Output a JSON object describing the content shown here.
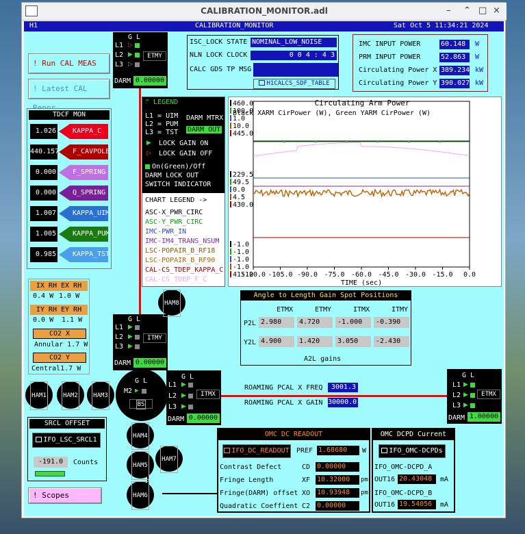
{
  "window": {
    "title": "CALIBRATION_MONITOR.adl",
    "controls": [
      "–",
      "□",
      "×"
    ]
  },
  "header": {
    "ifo": "H1",
    "title": "CALIBRATION_MONITOR",
    "datetime": "Sat Oct  5 11:34:21 2024"
  },
  "buttons": {
    "run_cal": "! Run CAL MEAS",
    "latest_cal": "! Latest CAL Repor",
    "scopes": "! Scopes"
  },
  "tdcf": {
    "title": "TDCF MON",
    "rows": [
      {
        "value": "1.026",
        "label": "KAPPA_C",
        "color": "#e8001c"
      },
      {
        "value": "440.157",
        "label": "F_CAVPOLE",
        "color": "#b00000"
      },
      {
        "value": "0.000",
        "label": "F_SPRING",
        "color": "#c070e0"
      },
      {
        "value": "0.000",
        "label": "Q_SPRING",
        "color": "#7a1f9a"
      },
      {
        "value": "1.007",
        "label": "KAPPA_UIM",
        "color": "#2a70d0"
      },
      {
        "value": "1.005",
        "label": "KAPPA_PUM",
        "color": "#1a7a10"
      },
      {
        "value": "0.985",
        "label": "KAPPA_TST",
        "color": "#4aa0e8"
      }
    ]
  },
  "ring_heaters": {
    "x_label": "IX RH EX RH",
    "x_vals": [
      "0.4 W",
      "1.0  W"
    ],
    "y_label": "IY RH EY RH",
    "y_vals": [
      "0.0 W",
      "1.1 W"
    ],
    "co2x_label": "CO2 X",
    "annular": "Annular 1.7 W",
    "co2y_label": "CO2 Y",
    "central": "Central1.7  W"
  },
  "srcl": {
    "title": "SRCL OFFSET",
    "button": "IFO_LSC_SRCL1",
    "value": "-191.0",
    "unit": "Counts"
  },
  "isc": {
    "state_label": "ISC_LOCK STATE",
    "state_value": "NOMINAL_LOW_NOISE",
    "nln_label": "NLN LOCK CLOCK",
    "nln_value": "0 0 4 : 4 3",
    "calc_label": "CALC GDS TP MSG",
    "sdf_button": "H1CALCS_SDF_TABLE"
  },
  "power": {
    "rows": [
      {
        "label": "IMC INPUT POWER",
        "value": "60.148",
        "unit": "W"
      },
      {
        "label": "PRM INPUT POWER",
        "value": "52.863",
        "unit": "W"
      },
      {
        "label": "Circulating Power X",
        "value": "389.234",
        "unit": "kW"
      },
      {
        "label": "Circulating Power Y",
        "value": "390.027",
        "unit": "kW"
      }
    ]
  },
  "legend": {
    "title": "LEGEND",
    "l1": "L1 = UIM",
    "l2": "L2 = PUM",
    "l3": "L3 = TST",
    "darm_mtrx": "DARM MTRX",
    "darm_out": "DARM OUT",
    "gain_on": "LOCK GAIN ON",
    "gain_off": "LOCK GAIN OFF",
    "onoff": "On(Green)/Off",
    "lockout": "DARM LOCK OUT",
    "switch": "SWITCH INDICATOR",
    "chart_legend": "CHART LEGEND  ->",
    "channels": [
      {
        "name": "ASC-X_PWR_CIRC",
        "color": "#000000"
      },
      {
        "name": "ASC-Y_PWR_CIRC",
        "color": "#10a010"
      },
      {
        "name": "IMC-PWR_IN",
        "color": "#2a4ad0"
      },
      {
        "name": "IMC-IM4_TRANS_NSUM",
        "color": "#7a2ab0"
      },
      {
        "name": "LSC-POPAIR_B_RF18",
        "color": "#8a5a00"
      },
      {
        "name": "LSC-POPAIR_B_RF90",
        "color": "#c06000"
      },
      {
        "name": "CAL-CS_TDEP_KAPPA_C",
        "color": "#a00000"
      },
      {
        "name": "CAL-CS_TDEP_F_C",
        "color": "#ffa0ff"
      }
    ]
  },
  "chart": {
    "title": "Circulating Arm Power",
    "subtitle": "Black XARM CirPower (W), Green YARM CirPower (W)",
    "xlabel": "TIME (sec)",
    "y_group1": [
      "460.0",
      "100.0",
      "1.0",
      "10.0",
      "445.0"
    ],
    "y_group2": [
      "229.5",
      "49.5",
      "0.0",
      "4.5",
      "430.0"
    ],
    "y_group3": [
      "-1.0",
      "-1.0",
      "-1.0",
      "-1.0",
      "415.0"
    ]
  },
  "chart_data": {
    "type": "line",
    "title": "Circulating Arm Power",
    "xlabel": "TIME (sec)",
    "x_ticks": [
      "-120.0",
      "-105.0",
      "-90.0",
      "-75.0",
      "-60.0",
      "-45.0",
      "-30.0",
      "-15.0",
      "0.0"
    ],
    "xlim": [
      -120,
      0
    ]
  },
  "a2l": {
    "title": "Angle to Length Gain Spot Positions",
    "cols": [
      "ETMX",
      "ETMY",
      "ITMX",
      "ITMY"
    ],
    "p2l_label": "P2L",
    "p2l": [
      "2.980",
      "4.720",
      "-1.000",
      "-0.390"
    ],
    "y2l_label": "Y2L",
    "y2l": [
      "4.900",
      "1.420",
      "3.050",
      "-2.430"
    ],
    "footer": "A2L gains"
  },
  "pcal": {
    "freq_label": "ROAMING PCAL X FREQ",
    "freq_value": "3001.3",
    "gain_label": "ROAMING PCAL X GAIN",
    "gain_value": "30000.0"
  },
  "omc": {
    "title": "OMC DC READOUT",
    "button": "IFO_DC_READOUT",
    "pref_label": "PREF",
    "pref_value": "1.68680",
    "pref_unit": "W",
    "rows": [
      {
        "label": "Contrast Defect",
        "code": "CD",
        "value": "0.00000",
        "unit": ""
      },
      {
        "label": "Fringe Length",
        "code": "XF",
        "value": "10.32000",
        "unit": "pm"
      },
      {
        "label": "Fringe(DARM) offset",
        "code": "XO",
        "value": "10.93948",
        "unit": "pm"
      },
      {
        "label": "Quadratic Coeffient",
        "code": "C2",
        "value": "0.00000",
        "unit": ""
      }
    ]
  },
  "dcpd": {
    "title": "OMC DCPD Current",
    "button": "IFO_OMC-DCPDs",
    "a_label": "IFO_OMC-DCPD_A",
    "a_out": "OUT16",
    "a_value": "20.43048",
    "a_unit": "mA",
    "b_label": "IFO_OMC-DCPD_B",
    "b_out": "OUT16",
    "b_value": "19.54056",
    "b_unit": "mA"
  },
  "suspensions": {
    "gl": "G L",
    "l1": "L1",
    "l2": "L2",
    "l3": "L3",
    "m2": "M2",
    "darm": "DARM",
    "etmy": {
      "name": "ETMY",
      "darm": "0.00000"
    },
    "itmy": {
      "name": "ITMY",
      "darm": "0.00000"
    },
    "itmx": {
      "name": "ITMX",
      "darm": "0.00000"
    },
    "etmx": {
      "name": "ETMX",
      "darm": "1.00000"
    },
    "bs": "BS",
    "hams": [
      "HAM1",
      "HAM2",
      "HAM3",
      "HAM4",
      "HAM5",
      "HAM6",
      "HAM7",
      "HAM8"
    ]
  }
}
